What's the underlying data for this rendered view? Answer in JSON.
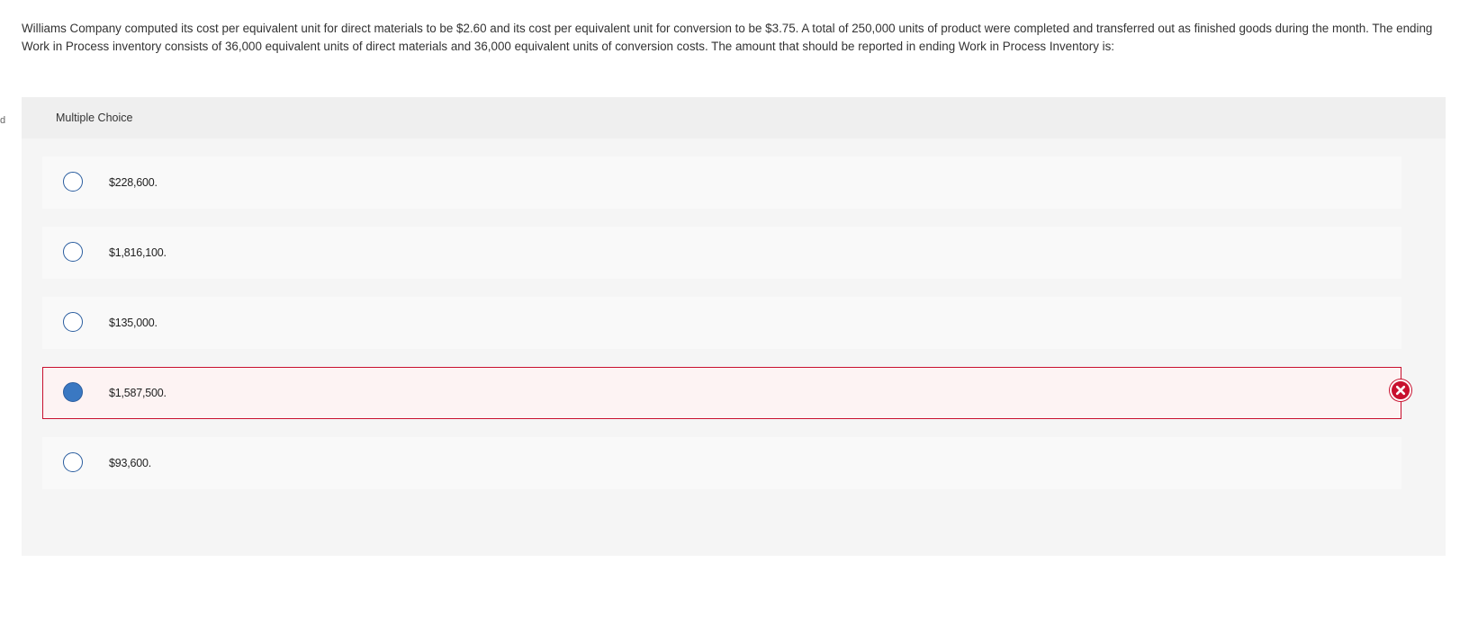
{
  "edge_mark": "d",
  "question": "Williams Company computed its cost per equivalent unit for direct materials to be $2.60 and its cost per equivalent unit for conversion to be $3.75. A total of 250,000 units of product were completed and transferred out as finished goods during the month. The ending Work in Process inventory consists of 36,000 equivalent units of direct materials and 36,000 equivalent units of conversion costs. The amount that should be reported in ending Work in Process Inventory is:",
  "panel": {
    "label": "Multiple Choice"
  },
  "choices": [
    {
      "text": "$228,600.",
      "selected": false,
      "status": ""
    },
    {
      "text": "$1,816,100.",
      "selected": false,
      "status": ""
    },
    {
      "text": "$135,000.",
      "selected": false,
      "status": ""
    },
    {
      "text": "$1,587,500.",
      "selected": true,
      "status": "incorrect"
    },
    {
      "text": "$93,600.",
      "selected": false,
      "status": ""
    }
  ],
  "icons": {
    "incorrect": "x-circle-icon"
  },
  "colors": {
    "incorrect": "#c8102e",
    "radio_border": "#2a5d9f",
    "radio_selected": "#3a78c2"
  }
}
